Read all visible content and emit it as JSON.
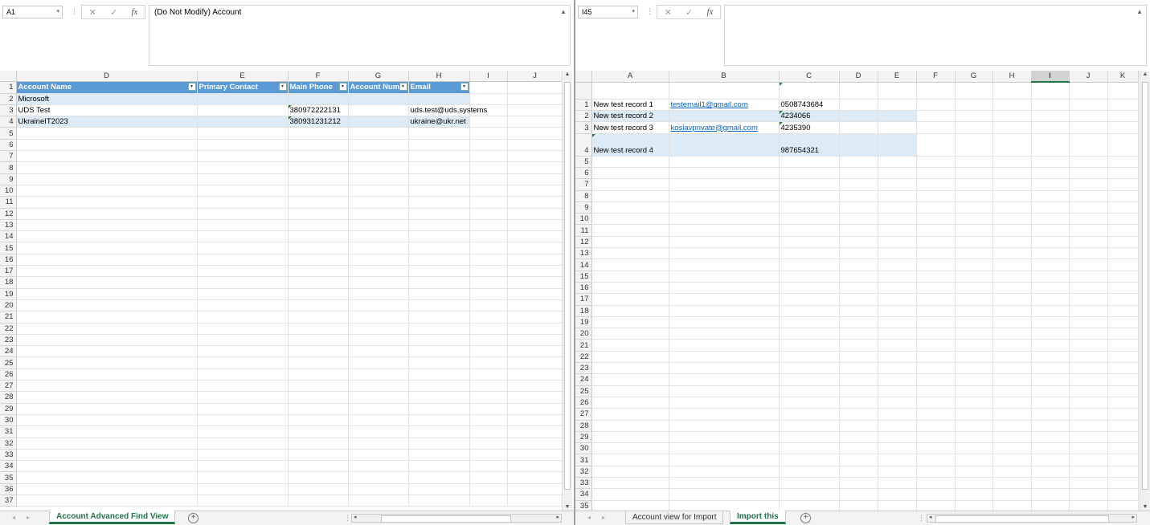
{
  "left": {
    "name_box": "A1",
    "formula": "(Do Not Modify) Account",
    "columns": [
      "D",
      "E",
      "F",
      "G",
      "H",
      "I",
      "J"
    ],
    "headers": [
      "Account Name",
      "Primary Contact",
      "Main Phone",
      "Account Num",
      "Email"
    ],
    "rows": [
      {
        "n": "2",
        "cells": [
          "Microsoft",
          "",
          "",
          "",
          "",
          "",
          ""
        ]
      },
      {
        "n": "3",
        "cells": [
          "UDS Test",
          "",
          "380972222131",
          "",
          "uds.test@uds.systems",
          "",
          ""
        ]
      },
      {
        "n": "4",
        "cells": [
          "UkraineIT2023",
          "",
          "380931231212",
          "",
          "ukraine@ukr.net",
          "",
          ""
        ]
      }
    ],
    "empty_rows": [
      "5",
      "6",
      "7",
      "8",
      "9",
      "10",
      "11",
      "12",
      "13",
      "14",
      "15",
      "16",
      "17",
      "18",
      "19",
      "20",
      "21",
      "22",
      "23",
      "24",
      "25",
      "26",
      "27",
      "28",
      "29",
      "30",
      "31",
      "32",
      "33",
      "34",
      "35",
      "36",
      "37"
    ],
    "tabs": [
      "Account Advanced Find View"
    ]
  },
  "right": {
    "name_box": "I45",
    "formula": "",
    "columns": [
      "A",
      "B",
      "C",
      "D",
      "E",
      "F",
      "G",
      "H",
      "I",
      "J",
      "K"
    ],
    "rows": [
      {
        "n": "1",
        "cells": [
          "New test record 1",
          "testemail1@gmail.com",
          "0508743684"
        ]
      },
      {
        "n": "2",
        "cells": [
          "New test record 2",
          "",
          "4234066"
        ]
      },
      {
        "n": "3",
        "cells": [
          "New test record 3",
          "koslavprivate@gmail.com",
          "4235390"
        ]
      },
      {
        "n": "4",
        "cells": [
          "New test record 4",
          "",
          "987654321"
        ]
      }
    ],
    "empty_rows": [
      "5",
      "6",
      "7",
      "8",
      "9",
      "10",
      "11",
      "12",
      "13",
      "14",
      "15",
      "16",
      "17",
      "18",
      "19",
      "20",
      "21",
      "22",
      "23",
      "24",
      "25",
      "26",
      "27",
      "28",
      "29",
      "30",
      "31",
      "32",
      "33",
      "34",
      "35"
    ],
    "tabs": [
      "Account view for Import",
      "Import this"
    ]
  },
  "icons": {
    "cancel": "✕",
    "enter": "✓",
    "function": "fx",
    "dropdown": "▾",
    "add_sheet": "⊕",
    "nav_prev": "◀",
    "nav_next": "▶",
    "collapse": "▲",
    "scroll_down": "▼"
  },
  "colors": {
    "table_header": "#5b9bd5",
    "band": "#ddebf7",
    "accent": "#217346",
    "link": "#0563c1"
  }
}
